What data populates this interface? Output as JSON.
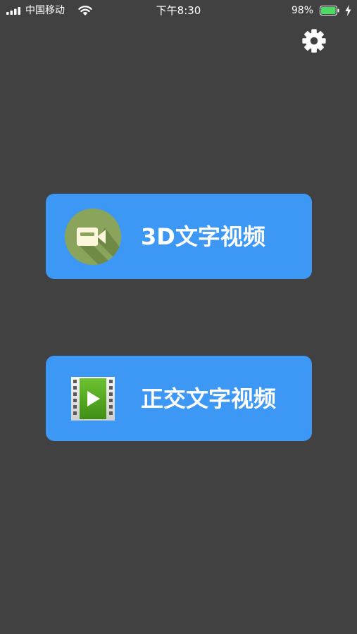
{
  "status_bar": {
    "carrier": "中国移动",
    "time": "下午8:30",
    "battery_percent": "98%",
    "battery_level": 0.98,
    "icons": [
      "signal-icon",
      "wifi-icon",
      "battery-icon",
      "charging-icon"
    ]
  },
  "header": {
    "settings_icon": "gear-icon"
  },
  "menu": {
    "items": [
      {
        "label": "3D文字视频",
        "icon": "video-camera-icon"
      },
      {
        "label": "正交文字视频",
        "icon": "film-play-icon"
      }
    ]
  },
  "colors": {
    "background": "#414141",
    "button": "#3d97f4",
    "text": "#ffffff",
    "battery_fill": "#4cd964",
    "camera_circle": "#8aa55b",
    "film_green": "#5bb326"
  }
}
